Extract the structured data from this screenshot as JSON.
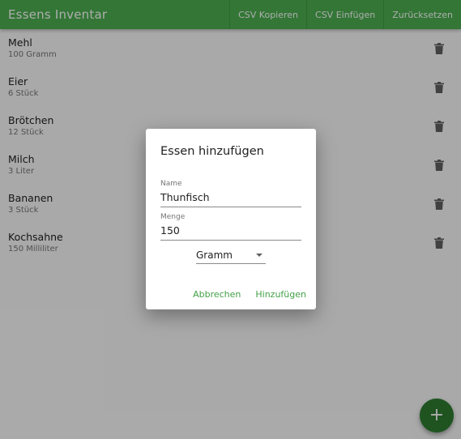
{
  "app": {
    "title": "Essens Inventar",
    "accent_color": "#4caf50",
    "actions": {
      "copy_csv": "CSV Kopieren",
      "paste_csv": "CSV Einfügen",
      "reset": "Zurücksetzen"
    }
  },
  "inventory": {
    "items": [
      {
        "name": "Mehl",
        "amount": "100 Gramm",
        "delete_icon": "trash-icon"
      },
      {
        "name": "Eier",
        "amount": "6 Stück",
        "delete_icon": "trash-icon"
      },
      {
        "name": "Brötchen",
        "amount": "12 Stück",
        "delete_icon": "trash-icon"
      },
      {
        "name": "Milch",
        "amount": "3 Liter",
        "delete_icon": "trash-icon"
      },
      {
        "name": "Bananen",
        "amount": "3 Stück",
        "delete_icon": "trash-icon"
      },
      {
        "name": "Kochsahne",
        "amount": "150 Milliliter",
        "delete_icon": "trash-icon"
      }
    ]
  },
  "fab": {
    "icon": "plus-icon",
    "symbol": "+",
    "color": "#2e7d32"
  },
  "dialog": {
    "title": "Essen hinzufügen",
    "name_field": {
      "label": "Name",
      "value": "Thunfisch"
    },
    "amount_field": {
      "label": "Menge",
      "value": "150"
    },
    "unit_select": {
      "value": "Gramm"
    },
    "cancel_label": "Abbrechen",
    "add_label": "Hinzufügen",
    "button_color": "#43a047"
  }
}
